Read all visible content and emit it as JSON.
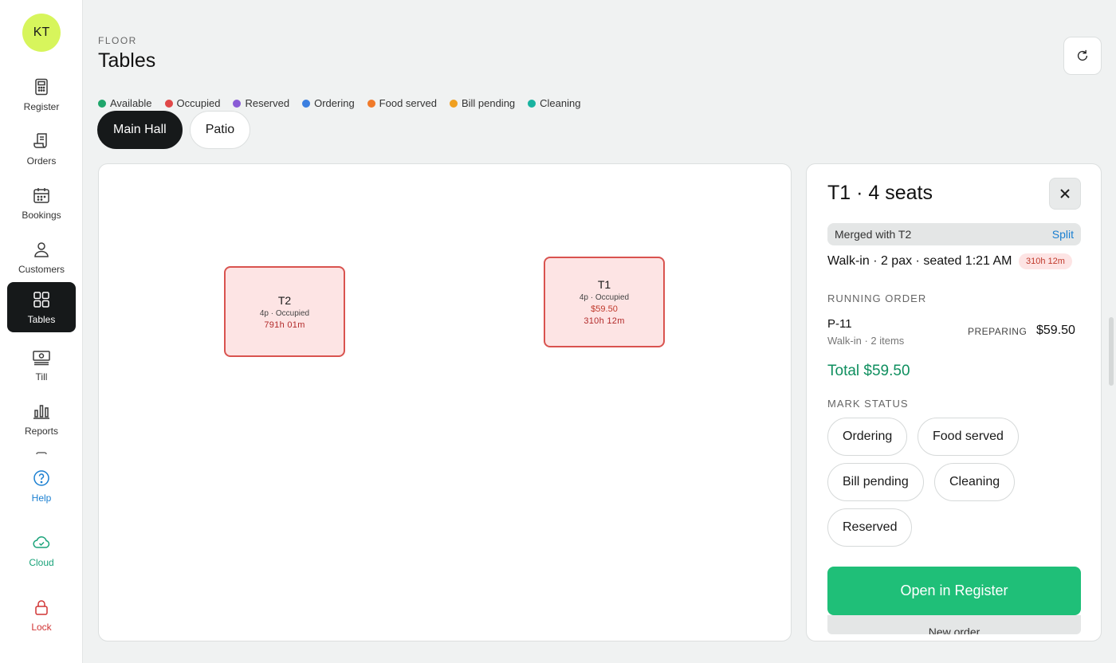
{
  "user": {
    "initials": "KT"
  },
  "nav": {
    "register": "Register",
    "orders": "Orders",
    "bookings": "Bookings",
    "customers": "Customers",
    "tables": "Tables",
    "till": "Till",
    "reports": "Reports",
    "help": "Help",
    "cloud": "Cloud",
    "lock": "Lock"
  },
  "header": {
    "eyebrow": "FLOOR",
    "title": "Tables"
  },
  "legend": [
    {
      "label": "Available",
      "color": "#1fa66b"
    },
    {
      "label": "Occupied",
      "color": "#e04848"
    },
    {
      "label": "Reserved",
      "color": "#8a5cd6"
    },
    {
      "label": "Ordering",
      "color": "#3b7fe0"
    },
    {
      "label": "Food served",
      "color": "#f07a2a"
    },
    {
      "label": "Bill pending",
      "color": "#f0a020"
    },
    {
      "label": "Cleaning",
      "color": "#19b3a0"
    }
  ],
  "zones": {
    "main": "Main Hall",
    "patio": "Patio"
  },
  "floor_tables": {
    "t2": {
      "name": "T2",
      "meta": "4p · Occupied",
      "time": "791h 01m"
    },
    "t1": {
      "name": "T1",
      "meta": "4p · Occupied",
      "amount": "$59.50",
      "time": "310h 12m"
    }
  },
  "panel": {
    "title": "T1 · 4 seats",
    "merged": "Merged with T2",
    "split": "Split",
    "party": "Walk-in · 2 pax · seated 1:21 AM",
    "elapsed": "310h 12m",
    "running_label": "RUNNING ORDER",
    "order": {
      "id": "P-11",
      "sub": "Walk-in · 2 items",
      "status": "PREPARING",
      "amount": "$59.50"
    },
    "total": "Total $59.50",
    "mark_label": "MARK STATUS",
    "status_buttons": {
      "ordering": "Ordering",
      "food_served": "Food served",
      "bill_pending": "Bill pending",
      "cleaning": "Cleaning",
      "reserved": "Reserved"
    },
    "primary": "Open in Register",
    "secondary": "New order"
  }
}
